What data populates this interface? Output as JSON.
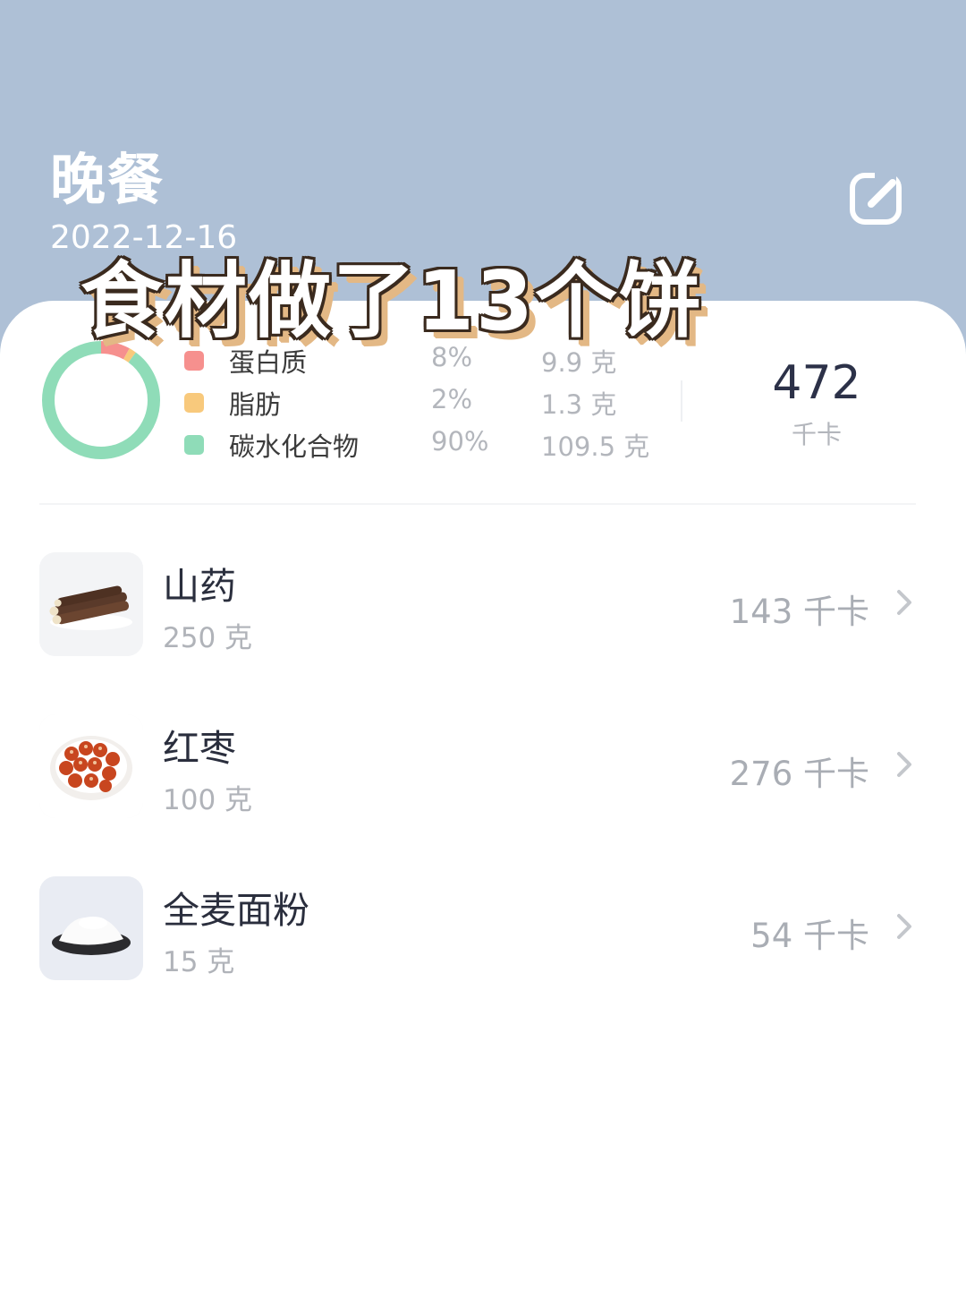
{
  "header": {
    "meal_title": "晚餐",
    "date": "2022-12-16",
    "edit_icon": "edit-icon"
  },
  "overlay_caption": "食材做了13个饼",
  "nutrition": {
    "macros": [
      {
        "name": "蛋白质",
        "percent": "8%",
        "amount": "9.9 克",
        "color": "#f6908e"
      },
      {
        "name": "脂肪",
        "percent": "2%",
        "amount": "1.3 克",
        "color": "#f8c97c"
      },
      {
        "name": "碳水化合物",
        "percent": "90%",
        "amount": "109.5 克",
        "color": "#8fdcb8"
      }
    ],
    "ring_fractions": [
      0.08,
      0.02,
      0.9
    ],
    "total_kcal": "472",
    "kcal_unit": "千卡"
  },
  "foods": [
    {
      "name": "山药",
      "weight": "250 克",
      "kcal": "143 千卡",
      "icon": "yam-image"
    },
    {
      "name": "红枣",
      "weight": "100 克",
      "kcal": "276 千卡",
      "icon": "red-dates-image"
    },
    {
      "name": "全麦面粉",
      "weight": "15 克",
      "kcal": "54 千卡",
      "icon": "whole-wheat-flour-image"
    }
  ],
  "colors": {
    "header_bg": "#aec0d6",
    "card_bg": "#ffffff",
    "primary_text": "#2a2e3d",
    "secondary_text": "#b0b3b9"
  }
}
